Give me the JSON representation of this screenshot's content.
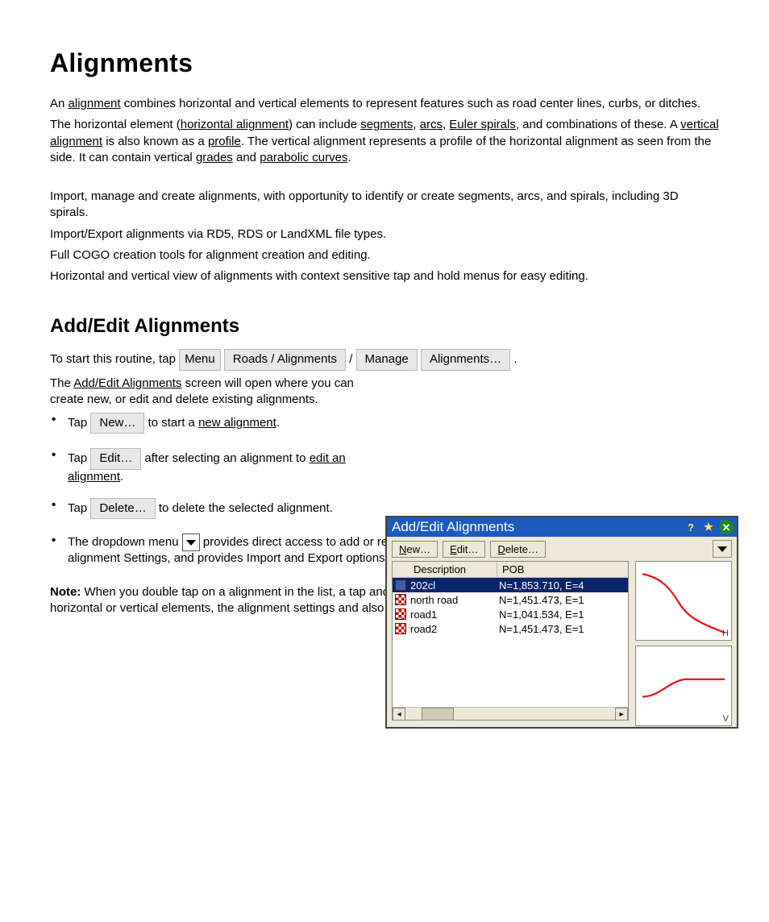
{
  "page": {
    "title": "Alignments",
    "intro_sentence_prefix": "An ",
    "intro_link_alignment": "alignment",
    "intro_sentence_rest": " combines horizontal and vertical elements to represent features such as road center lines, curbs, or ditches.",
    "intro_p2_a": "The horizontal element (",
    "intro_link_halign": "horizontal alignment",
    "intro_p2_b": ") can include ",
    "intro_link_seg": "segments",
    "intro_p2_c": ", ",
    "intro_link_arc": "arcs",
    "intro_p2_d": ", ",
    "intro_link_spi": "Euler spirals",
    "intro_p2_e": ", and combinations of these. A ",
    "intro_link_valign": "vertical alignment",
    "intro_p2_f": " is also known as a ",
    "intro_link_prof": "profile",
    "intro_p2_g": ". The vertical alignment represents a profile of the horizontal alignment as seen from the side. It can contain vertical ",
    "intro_link_grade": "grades",
    "intro_p2_h": " and ",
    "intro_link_curves": "parabolic curves",
    "intro_p2_i": ".",
    "feat_intro": "Import, manage and create alignments, with opportunity to identify or create segments, arcs, and spirals, including 3D spirals.",
    "feat_import": "Import/Export alignments via RD5, RDS or LandXML file types.",
    "feat_cogo": "Full COGO creation tools for alignment creation and editing.",
    "feat_views": "Horizontal and vertical view of alignments with context sensitive tap and hold menus for easy editing."
  },
  "aee": {
    "subtitle": "Add/Edit Alignments",
    "start_p1_a": "To start this routine, tap ",
    "start_chip1": "Menu",
    "start_chip2": "Roads / Alignments",
    "start_p1_b": " / ",
    "start_chip3": "Manage",
    "start_chip4": "Alignments…",
    "start_p1_c": ".",
    "intro_a": "The ",
    "intro_link": "Add/Edit Alignments",
    "intro_b": " screen will open where you can create new, or edit and delete existing alignments.",
    "bullets": {
      "new": {
        "prefix": "Tap ",
        "chip": "New…",
        "after": " to start a ",
        "link": "new alignment",
        "tail": "."
      },
      "edit": {
        "prefix": "Tap ",
        "chip": "Edit…",
        "after": " after selecting an alignment to ",
        "link": "edit an alignment",
        "tail": "."
      },
      "delete": {
        "prefix": "Tap ",
        "chip": "Delete…",
        "after": " to delete the selected alignment."
      },
      "dropdown": {
        "prefix": "The dropdown menu ",
        "after": " provides direct access to add or remove lines to or from the map, to view and edit the alignment Settings, and provides Import and Export options."
      }
    },
    "note": {
      "label": "Note:",
      "body": " When you double tap on a alignment in the list, a tap and hold menu gives you direct access to editing the horizontal or vertical elements, the alignment settings and also provides a delete option."
    }
  },
  "dialog": {
    "title": "Add/Edit Alignments",
    "buttons": {
      "new": "New…",
      "edit": "Edit…",
      "delete": "Delete…"
    },
    "columns": {
      "desc": "Description",
      "pob": "POB"
    },
    "rows": [
      {
        "desc": "202cl",
        "pob": "N=1,853.710, E=4",
        "selected": true
      },
      {
        "desc": "north road",
        "pob": "N=1,451.473, E=1",
        "selected": false
      },
      {
        "desc": "road1",
        "pob": "N=1,041.534, E=1",
        "selected": false
      },
      {
        "desc": "road2",
        "pob": "N=1,451.473, E=1",
        "selected": false
      }
    ],
    "preview_labels": {
      "h": "H",
      "v": "V"
    }
  }
}
